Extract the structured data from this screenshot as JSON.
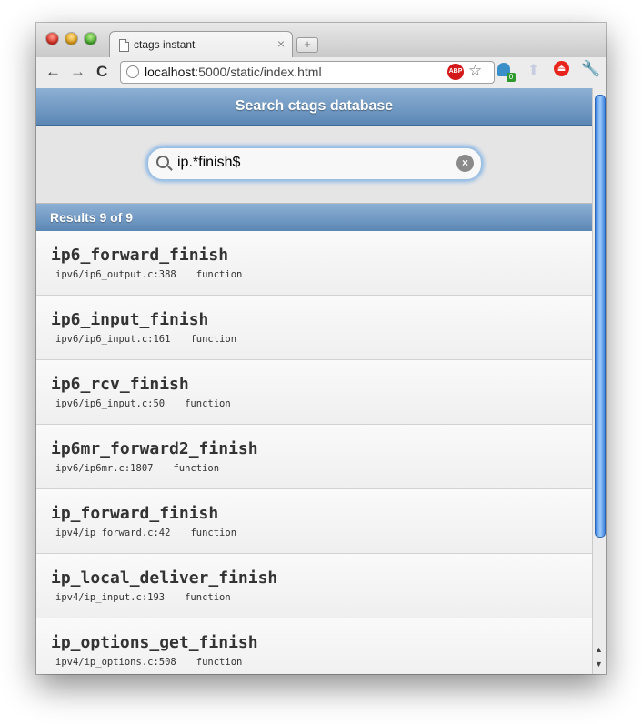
{
  "browser": {
    "tab_title": "ctags instant",
    "tab_close": "×",
    "new_tab": "+",
    "url_host": "localhost",
    "url_path": ":5000/static/index.html",
    "back": "←",
    "forward": "→",
    "reload": "C",
    "abp_label": "ABP",
    "star": "☆",
    "ext_badge": "0",
    "stop_label": "⏏",
    "wrench": "🔧"
  },
  "page": {
    "header_title": "Search ctags database",
    "search_value": "ip.*finish$",
    "clear_label": "×",
    "results_label": "Results 9 of 9",
    "results": [
      {
        "name": "ip6_forward_finish",
        "file": "ipv6/ip6_output.c:388",
        "kind": "function"
      },
      {
        "name": "ip6_input_finish",
        "file": "ipv6/ip6_input.c:161",
        "kind": "function"
      },
      {
        "name": "ip6_rcv_finish",
        "file": "ipv6/ip6_input.c:50",
        "kind": "function"
      },
      {
        "name": "ip6mr_forward2_finish",
        "file": "ipv6/ip6mr.c:1807",
        "kind": "function"
      },
      {
        "name": "ip_forward_finish",
        "file": "ipv4/ip_forward.c:42",
        "kind": "function"
      },
      {
        "name": "ip_local_deliver_finish",
        "file": "ipv4/ip_input.c:193",
        "kind": "function"
      },
      {
        "name": "ip_options_get_finish",
        "file": "ipv4/ip_options.c:508",
        "kind": "function"
      }
    ]
  },
  "colors": {
    "header_blue": "#6a93be",
    "focus_glow": "#86b5e6"
  }
}
